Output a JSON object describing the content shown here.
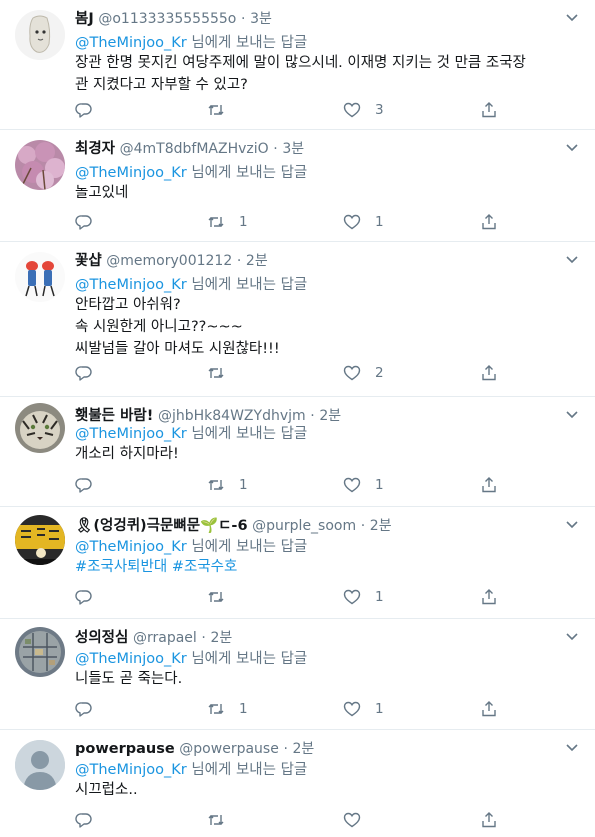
{
  "replying_label": "님에게 보내는 답글",
  "tweets": [
    {
      "name": "봄J",
      "handle": "@o113333555555o",
      "time": "3분",
      "mention": "@TheMinjoo_Kr",
      "lines": [
        "장관 한명 못지킨 여당주제에 말이 많으시네. 이재명 지키는 것 만큼 조국장",
        "관 지켰다고 자부할 수 있고?"
      ],
      "retweets": "",
      "likes": "3"
    },
    {
      "name": "최경자",
      "handle": "@4mT8dbfMAZHvziO",
      "time": "3분",
      "mention": "@TheMinjoo_Kr",
      "lines": [
        "놀고있네"
      ],
      "retweets": "1",
      "likes": "1"
    },
    {
      "name": "꽃샵",
      "handle": "@memory001212",
      "time": "2분",
      "mention": "@TheMinjoo_Kr",
      "lines": [
        "안타깝고 아쉬워?",
        "속 시원한게 아니고??~~~",
        "씨발넘들 갈아 마셔도 시원찮타!!!"
      ],
      "retweets": "",
      "likes": "2"
    },
    {
      "name": "횃불든 바람!",
      "handle": "@jhbHk84WZYdhvjm",
      "time": "2분",
      "mention": "@TheMinjoo_Kr",
      "lines": [
        "개소리 하지마라!"
      ],
      "retweets": "1",
      "likes": "1"
    },
    {
      "name": "🎗(엉겅퀴)극문뼈문🌱ㄷ-6",
      "handle": "@purple_soom",
      "time": "2분",
      "mention": "@TheMinjoo_Kr",
      "hashtags": [
        "#조국사퇴반대",
        "#조국수호"
      ],
      "lines": [],
      "retweets": "",
      "likes": "1"
    },
    {
      "name": "성의정심",
      "handle": "@rrapael",
      "time": "2분",
      "mention": "@TheMinjoo_Kr",
      "lines": [
        "니들도 곧 죽는다."
      ],
      "retweets": "1",
      "likes": "1"
    },
    {
      "name": "powerpause",
      "handle": "@powerpause",
      "time": "2분",
      "mention": "@TheMinjoo_Kr",
      "lines": [
        "시끄럽소.."
      ],
      "retweets": "",
      "likes": ""
    }
  ],
  "colors": {
    "link": "#1b95e0",
    "muted": "#657786",
    "text": "#14171a",
    "divider": "#e6ecf0"
  },
  "icons": {
    "reply": "reply-icon",
    "retweet": "retweet-icon",
    "like": "heart-icon",
    "share": "share-icon",
    "more": "chevron-down-icon"
  }
}
